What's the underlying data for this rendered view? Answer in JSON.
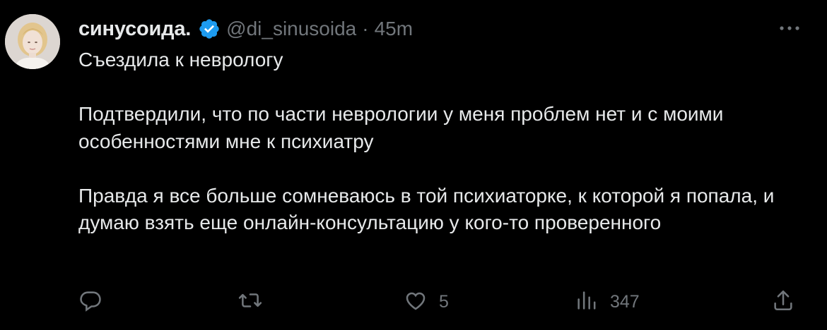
{
  "tweet": {
    "display_name": "синусоида.",
    "handle": "@di_sinusoida",
    "separator": "·",
    "time": "45m",
    "paragraphs": [
      "Съездила к неврологу",
      "Подтвердили, что по части неврологии у меня проблем нет и с моими особенностями мне к психиатру",
      "Правда я все больше сомневаюсь в той психиаторке, к которой я попала, и думаю взять еще онлайн-консультацию у кого-то проверенного"
    ],
    "likes": "5",
    "views": "347"
  },
  "icons": {
    "verified": "verified-badge-icon",
    "more": "more-horizontal-icon",
    "reply": "reply-icon",
    "retweet": "retweet-icon",
    "like": "heart-icon",
    "views": "views-chart-icon",
    "share": "share-icon"
  },
  "colors": {
    "background": "#000000",
    "text_primary": "#e7e9ea",
    "text_secondary": "#71767b",
    "verified_blue": "#1d9bf0"
  }
}
